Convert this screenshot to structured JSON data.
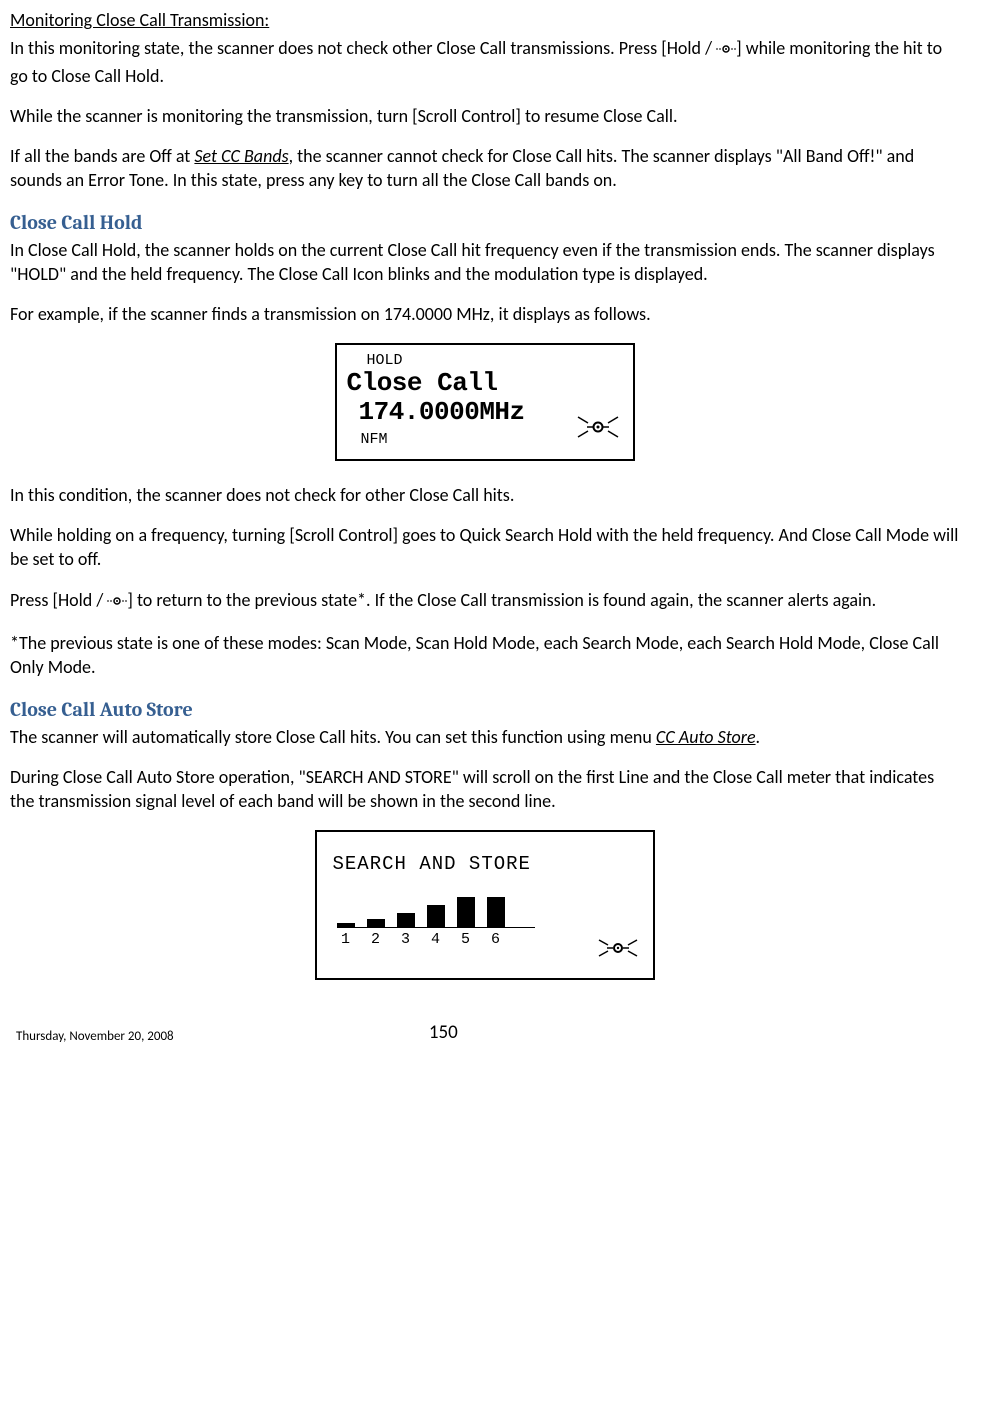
{
  "monitoring": {
    "heading": "Monitoring Close Call Transmission:",
    "p1a": "In this monitoring state, the scanner does not check other Close Call transmissions. Press [Hold / ",
    "p1b": "] while monitoring the hit to go to Close Call Hold.",
    "p2": "While the scanner is monitoring the transmission, turn [Scroll Control] to resume Close Call.",
    "p3a": "If all the bands are Off at ",
    "p3link": "Set CC Bands",
    "p3b": ", the scanner cannot check for Close Call hits. The scanner displays \"All Band Off!\" and sounds an Error Tone. In this state, press any key to turn all the Close Call bands on."
  },
  "cchold": {
    "heading": "Close Call Hold",
    "p1": "In Close Call Hold, the scanner holds on the current Close Call hit frequency even if the transmission ends. The scanner displays \"HOLD\" and the held frequency. The Close Call Icon blinks and the modulation type is displayed.",
    "p2": "For example, if the scanner finds a transmission on 174.0000 MHz, it displays as follows.",
    "lcd": {
      "hold": "HOLD",
      "title": "Close Call",
      "freq": "174.0000MHz",
      "mode": "NFM"
    },
    "p3": "In this condition, the scanner does not check for other Close Call hits.",
    "p4": "While holding on a frequency, turning [Scroll Control] goes to Quick Search Hold with the held frequency. And Close Call Mode will be set to off.",
    "p5a": "Press [Hold / ",
    "p5b": "] to return to the previous state*. If the Close Call transmission is found again, the scanner alerts again.",
    "p6": "*The previous state is one of these modes: Scan Mode, Scan Hold Mode, each Search Mode, each Search Hold Mode, Close Call Only Mode."
  },
  "ccauto": {
    "heading": "Close Call Auto Store",
    "p1a": "The scanner will automatically store Close Call hits. You can set this function using menu ",
    "p1link": "CC Auto Store",
    "p1b": ".",
    "p2": "During Close Call Auto Store operation, \"SEARCH AND STORE\" will scroll on the first Line and the Close Call meter that indicates the transmission signal level of each band will be shown in the second line.",
    "lcd": {
      "line": "SEARCH AND STORE",
      "chart_data": {
        "type": "bar",
        "categories": [
          "1",
          "2",
          "3",
          "4",
          "5",
          "6"
        ],
        "values": [
          4,
          8,
          14,
          22,
          30,
          30
        ],
        "ylim": [
          0,
          36
        ]
      }
    }
  },
  "footer": {
    "date": "Thursday, November 20, 2008",
    "page": "150"
  },
  "chart_data": {
    "type": "bar",
    "categories": [
      "1",
      "2",
      "3",
      "4",
      "5",
      "6"
    ],
    "values": [
      4,
      8,
      14,
      22,
      30,
      30
    ],
    "title": "",
    "xlabel": "",
    "ylabel": "",
    "ylim": [
      0,
      36
    ]
  }
}
